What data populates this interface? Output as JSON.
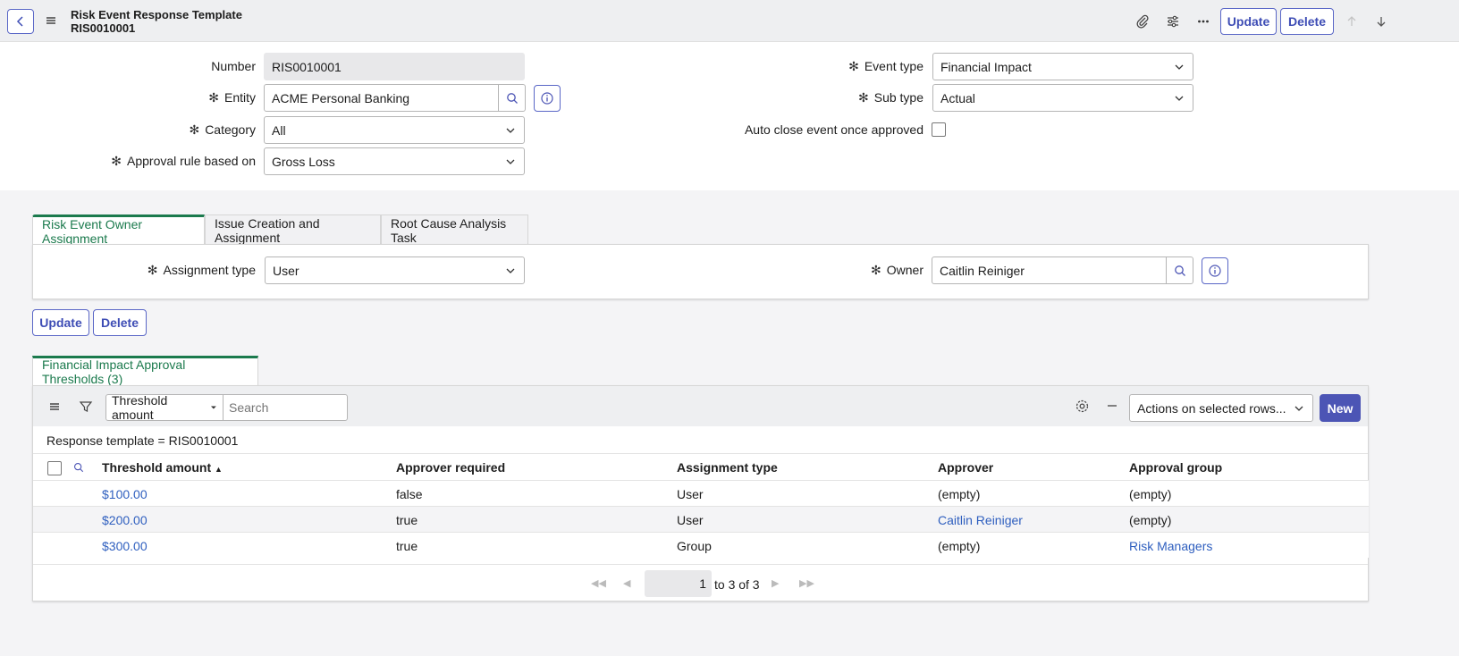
{
  "header": {
    "title": "Risk Event Response Template",
    "subtitle": "RIS0010001",
    "update_label": "Update",
    "delete_label": "Delete"
  },
  "form": {
    "number": {
      "label": "Number",
      "value": "RIS0010001"
    },
    "entity": {
      "label": "Entity",
      "value": "ACME Personal Banking"
    },
    "category": {
      "label": "Category",
      "value": "All"
    },
    "approval_rule": {
      "label": "Approval rule based on",
      "value": "Gross Loss"
    },
    "event_type": {
      "label": "Event type",
      "value": "Financial Impact"
    },
    "sub_type": {
      "label": "Sub type",
      "value": "Actual"
    },
    "auto_close": {
      "label": "Auto close event once approved",
      "checked": false
    }
  },
  "tabs": [
    {
      "label": "Risk Event Owner Assignment",
      "active": true
    },
    {
      "label": "Issue Creation and Assignment",
      "active": false
    },
    {
      "label": "Root Cause Analysis Task",
      "active": false
    }
  ],
  "assignment": {
    "type_label": "Assignment type",
    "type_value": "User",
    "owner_label": "Owner",
    "owner_value": "Caitlin Reiniger"
  },
  "actions": {
    "update_label": "Update",
    "delete_label": "Delete"
  },
  "related": {
    "tab_label": "Financial Impact Approval Thresholds (3)",
    "search_field": "Threshold amount",
    "search_placeholder": "Search",
    "actions_select": "Actions on selected rows...",
    "new_label": "New",
    "filter_text": "Response template = RIS0010001",
    "columns": [
      "Threshold amount",
      "Approver required",
      "Assignment type",
      "Approver",
      "Approval group"
    ],
    "rows": [
      {
        "amount": "$100.00",
        "required": "false",
        "type": "User",
        "approver": "(empty)",
        "group": "(empty)"
      },
      {
        "amount": "$200.00",
        "required": "true",
        "type": "User",
        "approver": "Caitlin Reiniger",
        "group": "(empty)"
      },
      {
        "amount": "$300.00",
        "required": "true",
        "type": "Group",
        "approver": "(empty)",
        "group": "Risk Managers"
      }
    ],
    "pager": {
      "page": "1",
      "range": "to 3 of 3"
    }
  },
  "colors": {
    "accent": "#1b7a4d",
    "primary": "#4c55b5",
    "link": "#2f5fbf"
  }
}
